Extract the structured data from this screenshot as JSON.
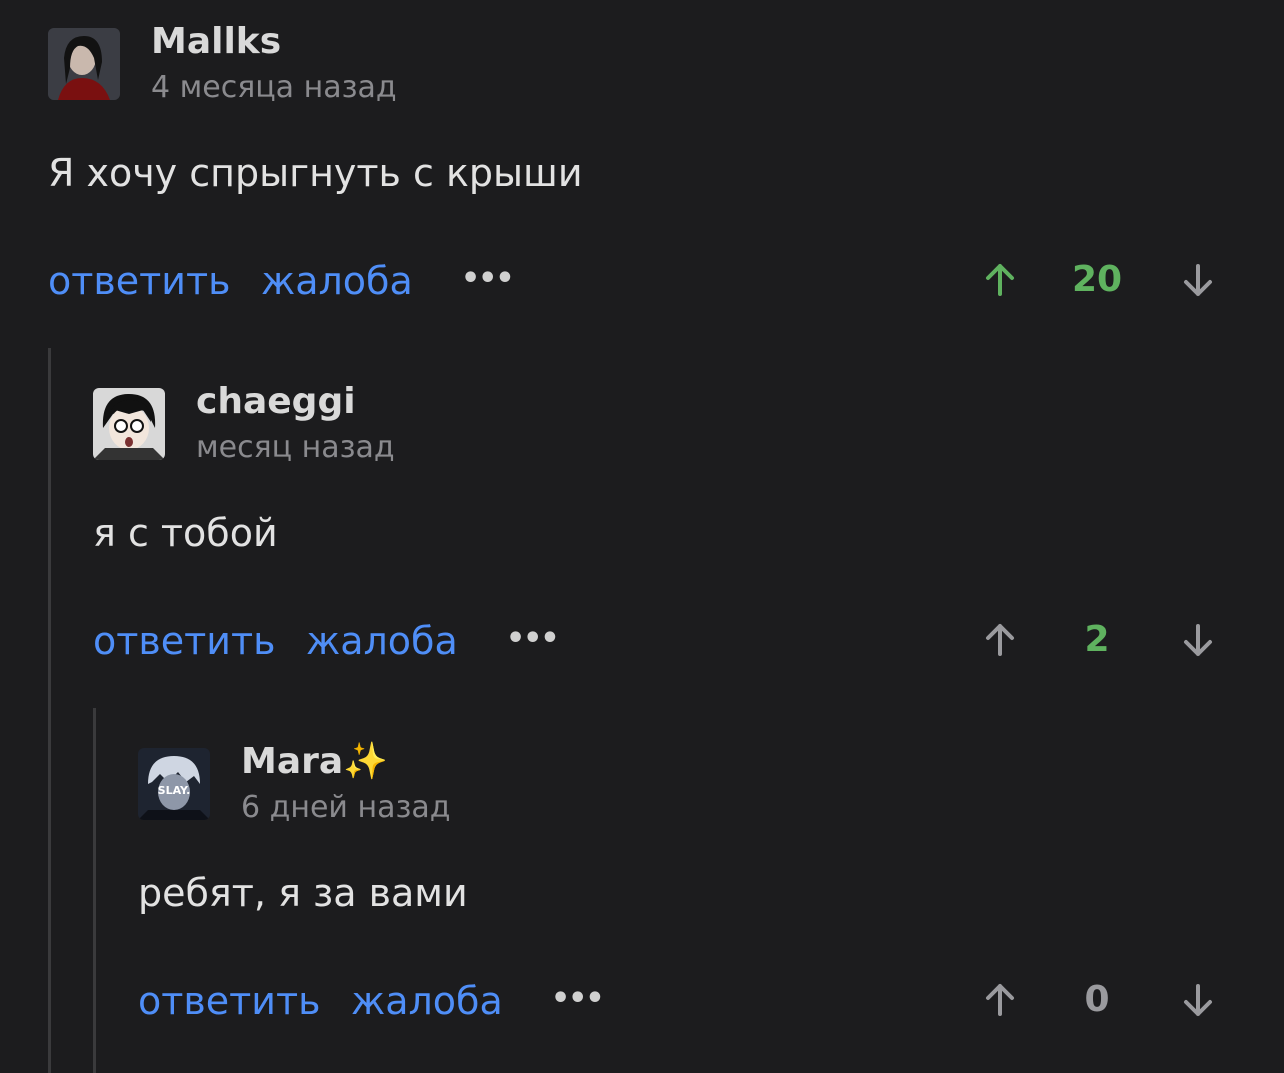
{
  "comments": [
    {
      "username": "Mallks",
      "time": "4 месяца назад",
      "text": "Я хочу спрыгнуть с крыши",
      "reply": "ответить",
      "report": "жалоба",
      "more": "•••",
      "score": "20",
      "score_color": "#5fb25f",
      "up_color": "#5fb25f"
    },
    {
      "username": "chaeggi",
      "time": "месяц назад",
      "text": "я с тобой",
      "reply": "ответить",
      "report": "жалоба",
      "more": "•••",
      "score": "2",
      "score_color": "#5fb25f",
      "up_color": "#9a9a9e"
    },
    {
      "username": "Mara✨",
      "time": "6 дней назад",
      "text": "ребят, я за вами",
      "reply": "ответить",
      "report": "жалоба",
      "more": "•••",
      "score": "0",
      "score_color": "#9a9a9e",
      "up_color": "#9a9a9e",
      "avatar_label": "SLAY."
    }
  ]
}
